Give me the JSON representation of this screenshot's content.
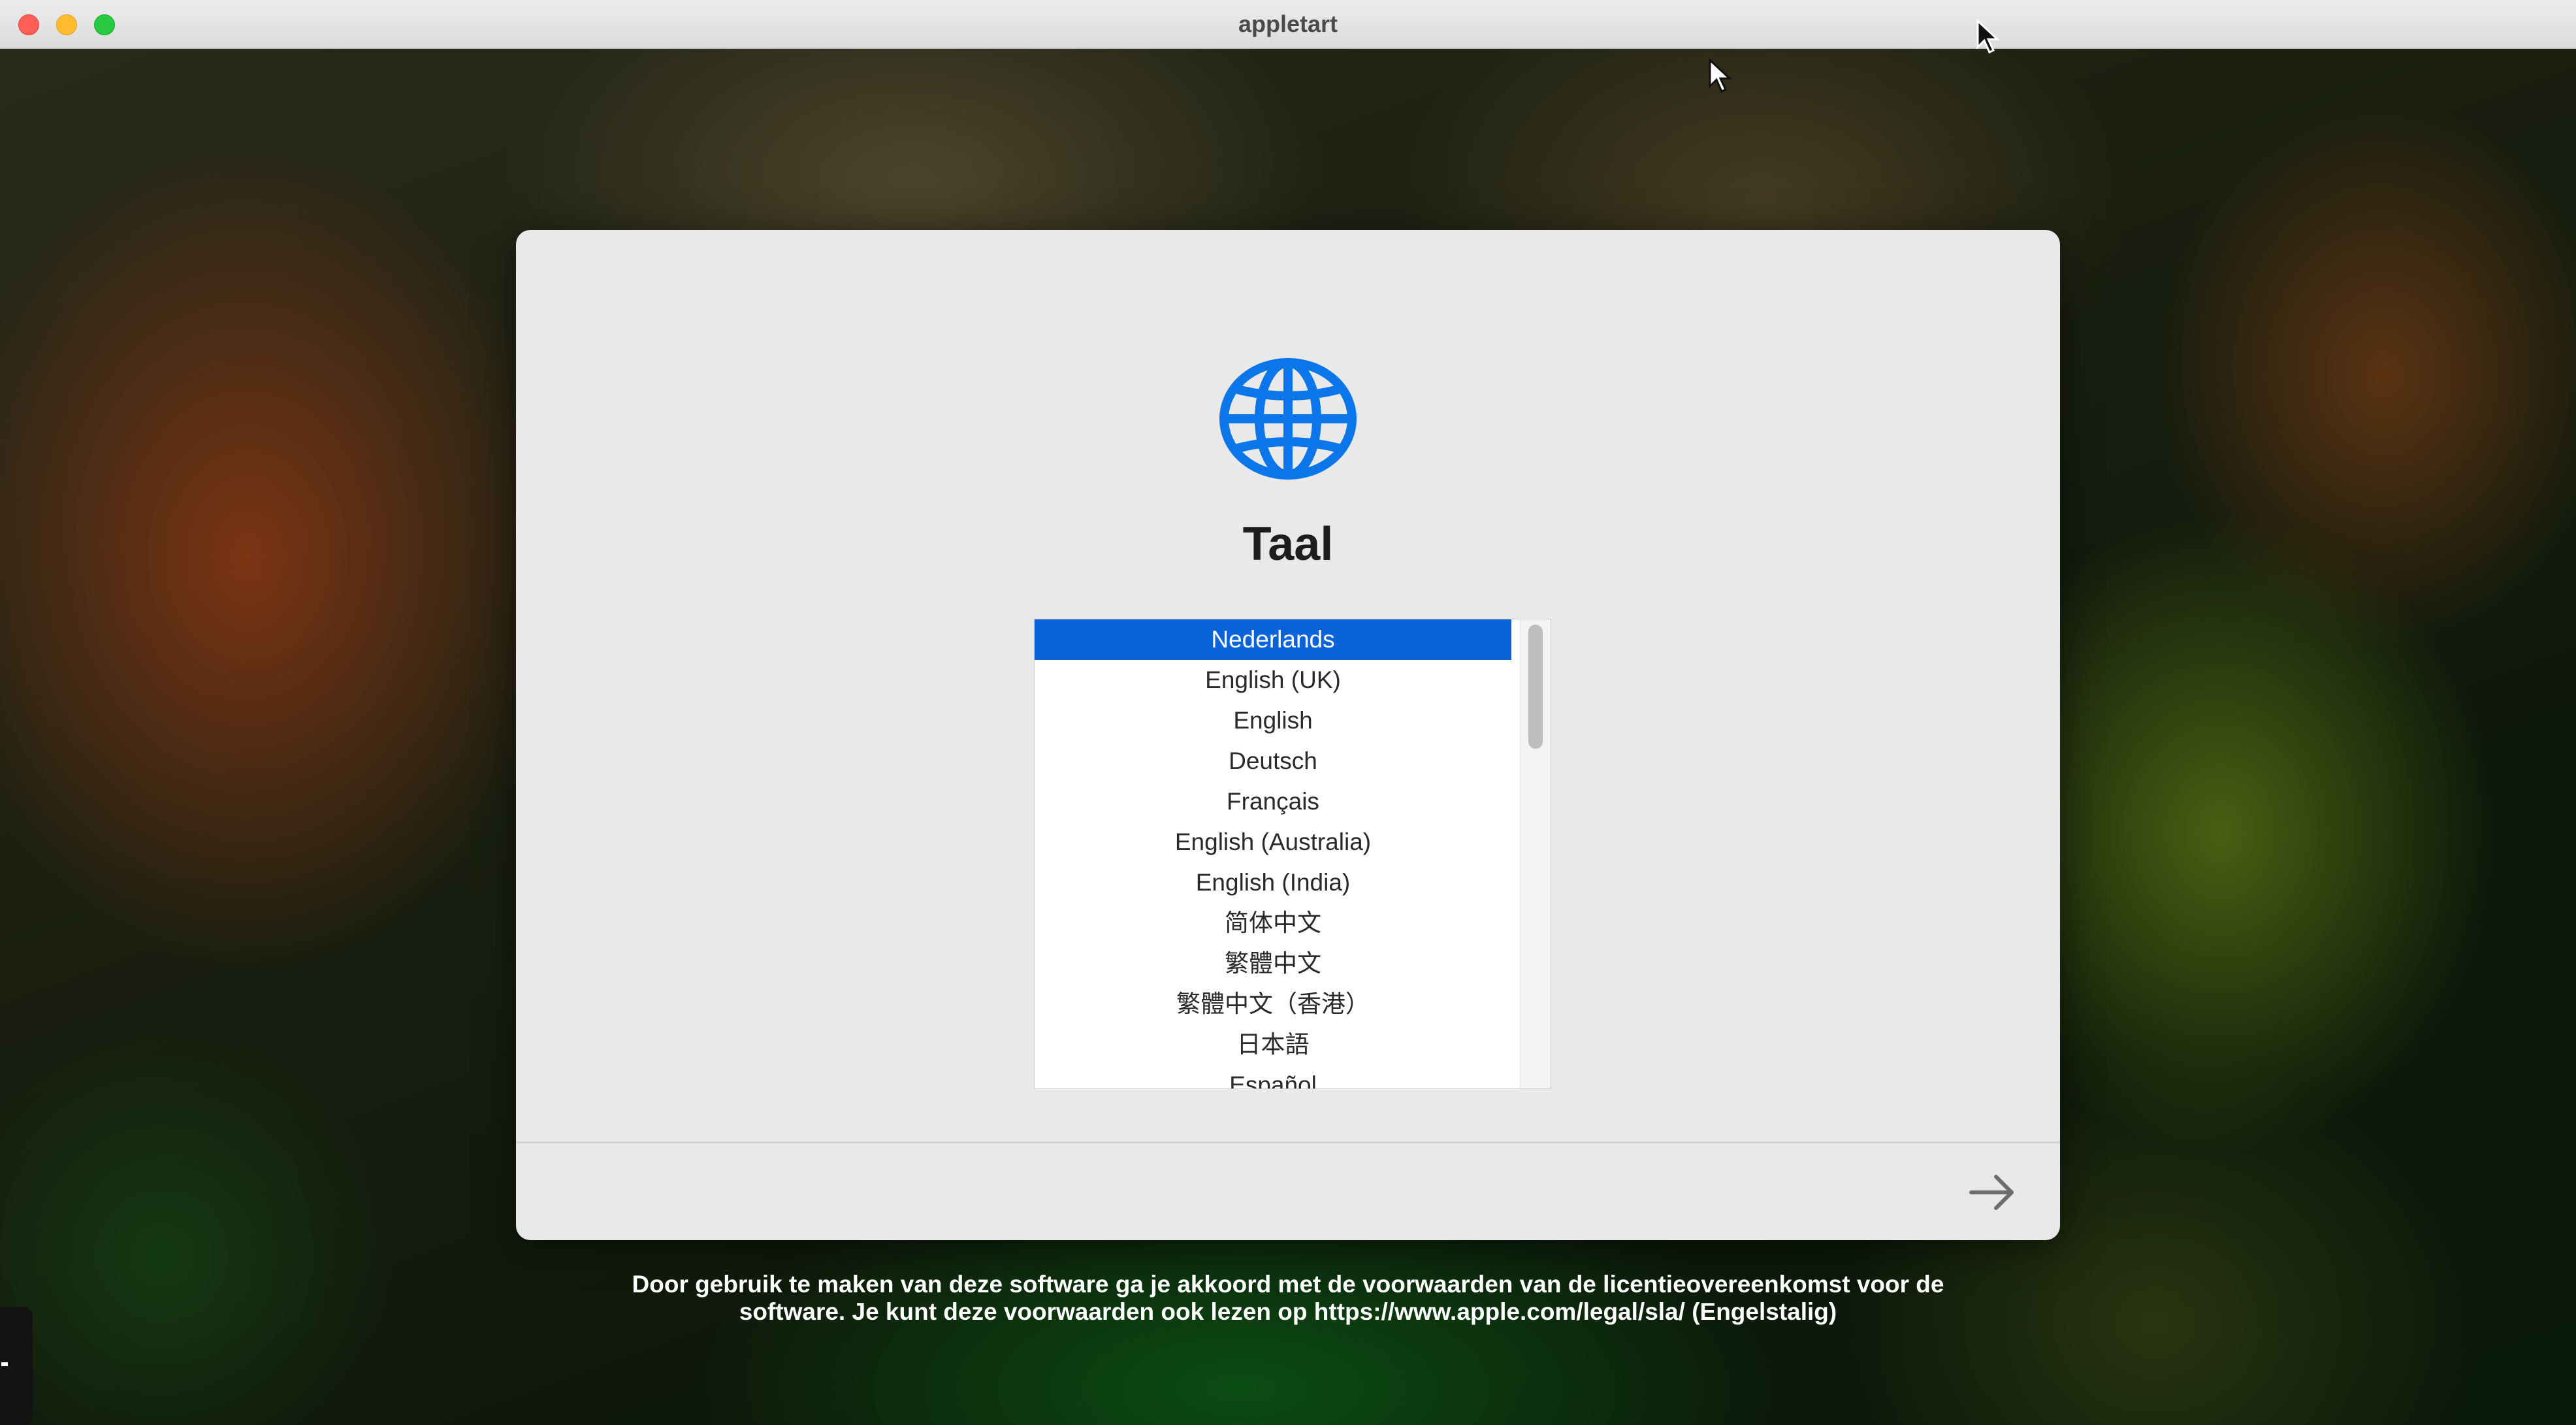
{
  "window": {
    "title": "appletart"
  },
  "setup": {
    "heading": "Taal",
    "icon": "globe-icon",
    "accent_color": "#0a63d8",
    "languages": [
      "Nederlands",
      "English (UK)",
      "English",
      "Deutsch",
      "Français",
      "English (Australia)",
      "English (India)",
      "简体中文",
      "繁體中文",
      "繁體中文（香港）",
      "日本語",
      "Español"
    ],
    "selected_language": "Nederlands",
    "next_icon": "arrow-right-icon"
  },
  "footer": {
    "line1": "Door gebruik te maken van deze software ga je akkoord met de voorwaarden van de licentieovereenkomst voor de",
    "line2": "software. Je kunt deze voorwaarden ook lezen op https://www.apple.com/legal/sla/ (Engelstalig)"
  }
}
